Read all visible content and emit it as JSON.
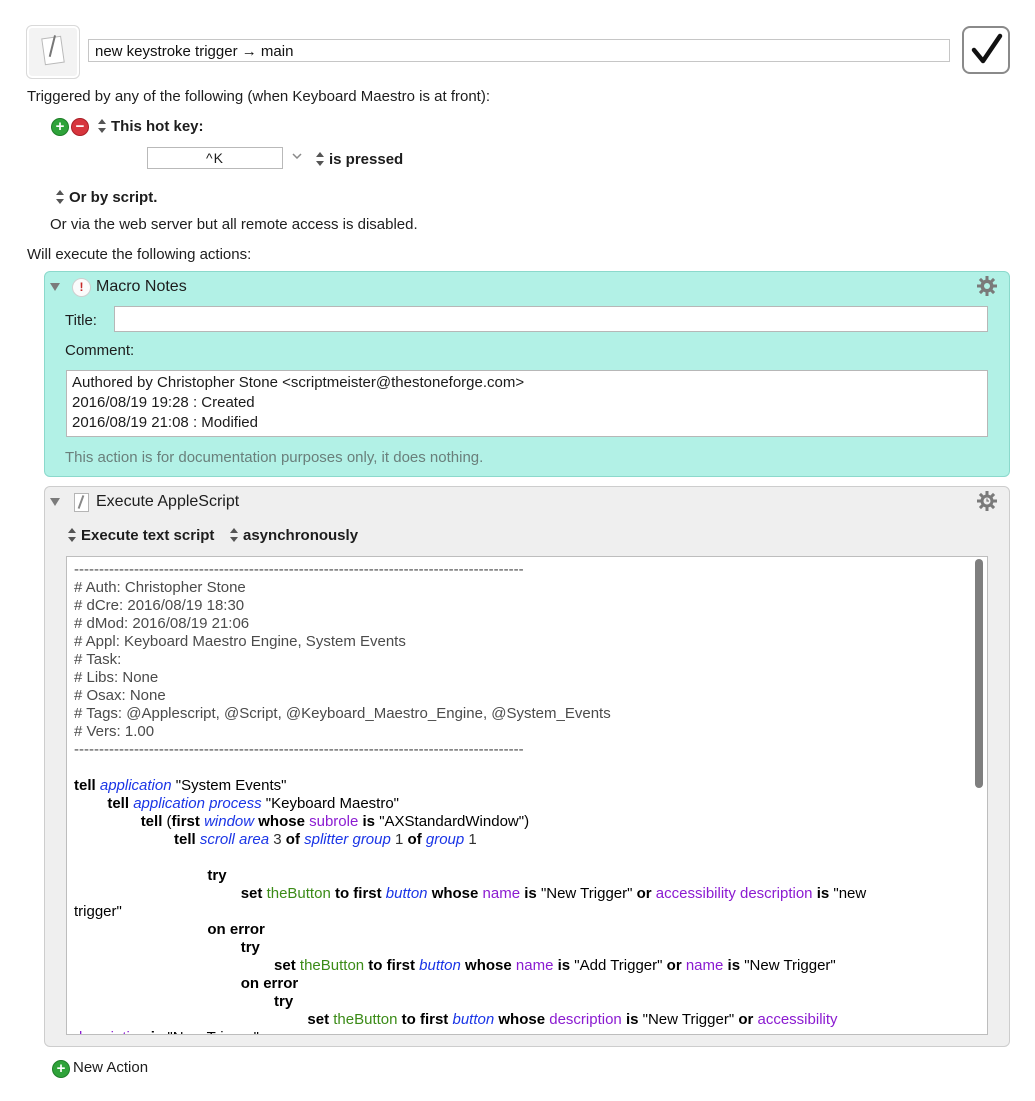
{
  "macro": {
    "name": "new keystroke trigger → main",
    "enabled": true
  },
  "triggers": {
    "intro": "Triggered by any of the following (when Keyboard Maestro is at front):",
    "hotkey_label": "This hot key:",
    "hotkey_value": "^K",
    "hotkey_state": "is pressed",
    "script_trigger": "Or by script.",
    "web_server": "Or via the web server but all remote access is disabled."
  },
  "actions_intro": "Will execute the following actions:",
  "macro_notes": {
    "header": "Macro Notes",
    "title_label": "Title:",
    "title_value": "",
    "comment_label": "Comment:",
    "comment_lines": [
      "Authored by Christopher Stone <scriptmeister@thestoneforge.com>",
      "2016/08/19 19:28 : Created",
      "2016/08/19 21:08 : Modified"
    ],
    "footnote": "This action is for documentation purposes only, it does nothing.",
    "panel_color": "#b2f1e6"
  },
  "applescript_action": {
    "header": "Execute AppleScript",
    "mode": "Execute text script",
    "timing": "asynchronously",
    "panel_color": "#efefef"
  },
  "new_action_label": "New Action",
  "colors": {
    "class_blue": "#1a35e6",
    "property_purple": "#8b1bd1",
    "variable_green": "#3b8b17",
    "add_green": "#2fa33a",
    "remove_red": "#d7353d"
  },
  "icons": [
    "macro-document-icon",
    "checkmark-icon",
    "add-icon",
    "remove-icon",
    "updown-chevron-icon",
    "chevron-down-icon",
    "disclosure-triangle-icon",
    "exclamation-icon",
    "gear-icon",
    "timer-gear-icon",
    "applescript-document-icon"
  ]
}
